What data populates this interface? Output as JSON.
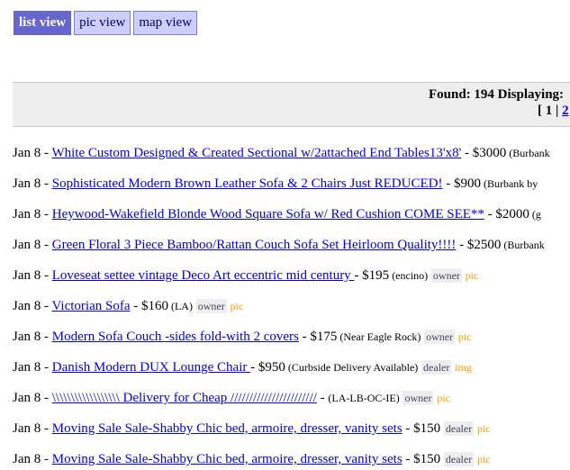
{
  "view_tabs": [
    {
      "label": "list view",
      "active": true
    },
    {
      "label": "pic view",
      "active": false
    },
    {
      "label": "map view",
      "active": false
    }
  ],
  "results": {
    "summary": "Found: 194 Displaying:",
    "pagination": {
      "open": "[ ",
      "page1": "1",
      "sep": " | ",
      "page2": "2",
      "close": " ]"
    }
  },
  "listings": [
    {
      "date": "Jan 8",
      "title": "White Custom Designed & Created Sectional w/2attached End Tables13'x8'",
      "price": " - $3000",
      "location": " (Burbank",
      "type": "",
      "media": ""
    },
    {
      "date": "Jan 8",
      "title": "Sophisticated Modern Brown Leather Sofa & 2 Chairs Just REDUCED!",
      "price": " - $900",
      "location": " (Burbank by",
      "type": "",
      "media": ""
    },
    {
      "date": "Jan 8",
      "title": "Heywood-Wakefield Blonde Wood Square Sofa w/ Red Cushion COME SEE**",
      "price": " - $2000",
      "location": " (g",
      "type": "",
      "media": ""
    },
    {
      "date": "Jan 8",
      "title": "Green Floral 3 Piece Bamboo/Rattan Couch Sofa Set Heirloom Quality!!!!",
      "price": " - $2500",
      "location": " (Burbank",
      "type": "",
      "media": ""
    },
    {
      "date": "Jan 8",
      "title": "Loveseat settee vintage Deco Art eccentric mid century ",
      "price": " - $195",
      "location": " (encino)",
      "type": "owner",
      "media": "pic"
    },
    {
      "date": "Jan 8",
      "title": "Victorian Sofa",
      "price": " - $160",
      "location": " (LA)",
      "type": "owner",
      "media": "pic"
    },
    {
      "date": "Jan 8",
      "title": "Modern Sofa Couch -sides fold-with 2 covers",
      "price": " - $175",
      "location": " (Near Eagle Rock)",
      "type": "owner",
      "media": "pic"
    },
    {
      "date": "Jan 8",
      "title": "Danish Modern DUX Lounge Chair ",
      "price": " - $950",
      "location": " (Curbside Delivery Available)",
      "type": "dealer",
      "media": "img"
    },
    {
      "date": "Jan 8",
      "title": "\\\\\\\\\\\\\\\\\\\\\\\\\\\\\\\\\\\\ Delivery for Cheap ///////////////////////",
      "price": " - ",
      "location": "(LA-LB-OC-IE)",
      "type": "owner",
      "media": "pic"
    },
    {
      "date": "Jan 8",
      "title": "Moving Sale Sale-Shabby Chic bed, armoire, dresser, vanity sets",
      "price": " - $150",
      "location": "",
      "type": "dealer",
      "media": "pic"
    },
    {
      "date": "Jan 8",
      "title": "Moving Sale Sale-Shabby Chic bed, armoire, dresser, vanity sets",
      "price": " - $150",
      "location": "",
      "type": "dealer",
      "media": "pic"
    }
  ]
}
